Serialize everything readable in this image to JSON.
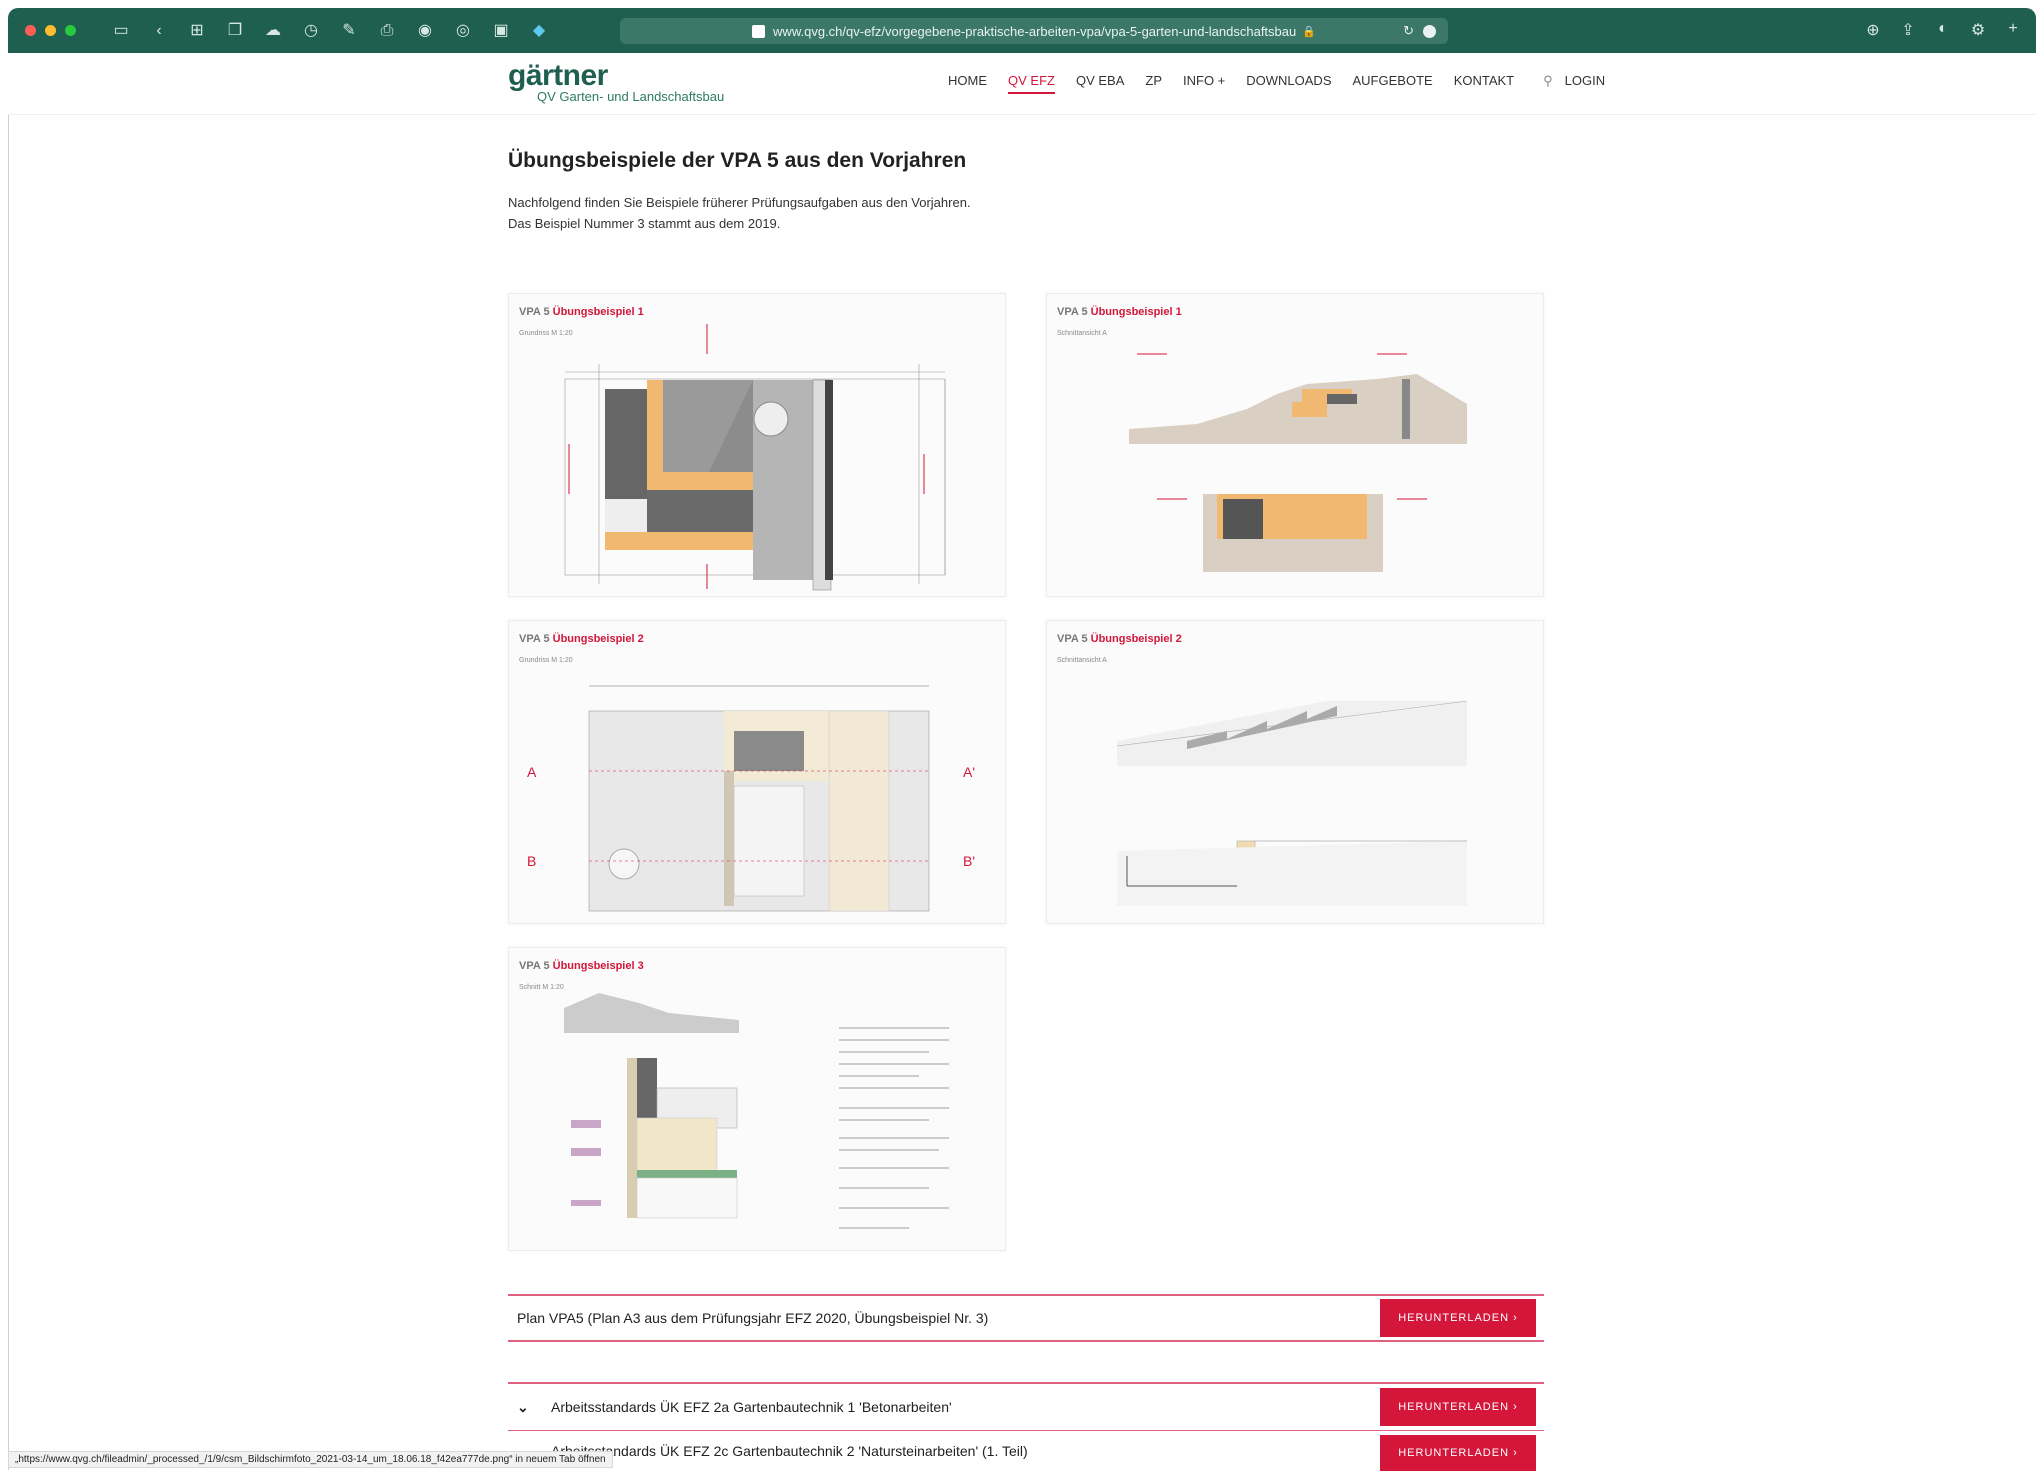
{
  "browser": {
    "url": "www.qvg.ch/qv-efz/vorgegebene-praktische-arbeiten-vpa/vpa-5-garten-und-landschaftsbau",
    "status_url": "„https://www.qvg.ch/fileadmin/_processed_/1/9/csm_Bildschirmfoto_2021-03-14_um_18.06.18_f42ea777de.png“ in neuem Tab öffnen",
    "chrome_color": "#1f5f4f"
  },
  "site": {
    "logo_name": "gärtner",
    "logo_sub": "QV Garten- und Landschaftsbau",
    "nav": [
      "HOME",
      "QV EFZ",
      "QV EBA",
      "ZP",
      "INFO +",
      "DOWNLOADS",
      "AUFGEBOTE",
      "KONTAKT"
    ],
    "login": "LOGIN",
    "accent": "#d3163a"
  },
  "main": {
    "title": "Übungsbeispiele der VPA 5 aus den Vorjahren",
    "intro_line1": "Nachfolgend finden Sie Beispiele früherer Prüfungsaufgaben aus den Vorjahren.",
    "intro_line2": "Das Beispiel Nummer 3 stammt aus dem 2019."
  },
  "cards": [
    {
      "prefix": "VPA 5",
      "title": "Übungsbeispiel 1",
      "sub": "Grundriss M 1:20"
    },
    {
      "prefix": "VPA 5",
      "title": "Übungsbeispiel 1",
      "sub": "Schnittansicht A"
    },
    {
      "prefix": "VPA 5",
      "title": "Übungsbeispiel 2",
      "sub": "Grundriss M 1:20"
    },
    {
      "prefix": "VPA 5",
      "title": "Übungsbeispiel 2",
      "sub": "Schnittansicht A"
    },
    {
      "prefix": "VPA 5",
      "title": "Übungsbeispiel 3",
      "sub": "Schnitt M 1:20"
    }
  ],
  "plan_labels": {
    "a": "A",
    "a_prime": "A'",
    "b": "B",
    "b_prime": "B'"
  },
  "downloads": [
    {
      "label": "Plan VPA5 (Plan A3 aus dem Prüfungsjahr EFZ 2020, Übungsbeispiel Nr. 3)",
      "button": "HERUNTERLADEN ›"
    },
    {
      "label": "Arbeitsstandards ÜK EFZ 2a Gartenbautechnik 1 'Betonarbeiten'",
      "button": "HERUNTERLADEN ›"
    },
    {
      "label": "Arbeitsstandards ÜK EFZ 2c Gartenbautechnik 2 'Natursteinarbeiten' (1. Teil)",
      "button": "HERUNTERLADEN ›"
    }
  ]
}
